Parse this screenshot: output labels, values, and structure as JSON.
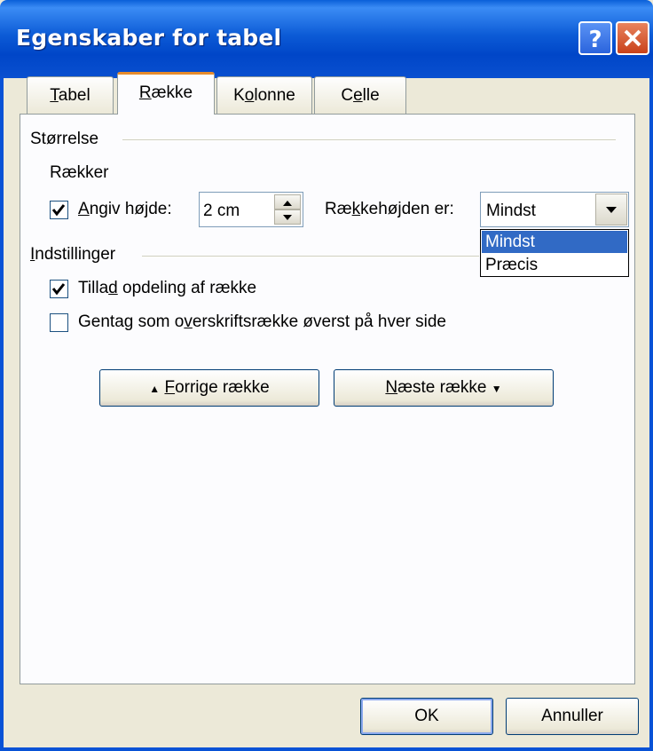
{
  "window": {
    "title": "Egenskaber for tabel",
    "help_glyph": "?",
    "close_glyph": "✕"
  },
  "tabs": [
    {
      "label": "Tabel",
      "mnemonic": "T",
      "rest": "abel"
    },
    {
      "label": "Række",
      "mnemonic": "R",
      "rest": "ække"
    },
    {
      "label": "Kolonne",
      "pre": "K",
      "mnemonic": "o",
      "rest": "lonne"
    },
    {
      "label": "Celle",
      "pre": "C",
      "mnemonic": "e",
      "rest": "lle"
    }
  ],
  "size_section": {
    "title": "Størrelse",
    "rows_label": "Rækker",
    "specify_height": {
      "checked": true,
      "label_mnemonic": "A",
      "label_rest": "ngiv højde:"
    },
    "height_value": "2 cm",
    "row_height_is": {
      "pre": "Ræ",
      "mnemonic": "k",
      "rest": "kehøjden er:"
    },
    "row_height_mode": "Mindst",
    "row_height_options": [
      "Mindst",
      "Præcis"
    ]
  },
  "options_section": {
    "title_mnemonic": "I",
    "title_rest": "ndstillinger",
    "allow_break": {
      "checked": true,
      "pre": "Tilla",
      "mnemonic": "d",
      "rest": " opdeling af række"
    },
    "repeat_header": {
      "checked": false,
      "pre": "Gentag som o",
      "mnemonic": "v",
      "rest": "erskriftsrække øverst på hver side"
    }
  },
  "nav": {
    "prev_mnemonic": "F",
    "prev_rest": "orrige række",
    "next_mnemonic": "N",
    "next_rest": "æste række",
    "up_glyph": "▲",
    "down_glyph": "▼"
  },
  "footer": {
    "ok": "OK",
    "cancel": "Annuller"
  }
}
